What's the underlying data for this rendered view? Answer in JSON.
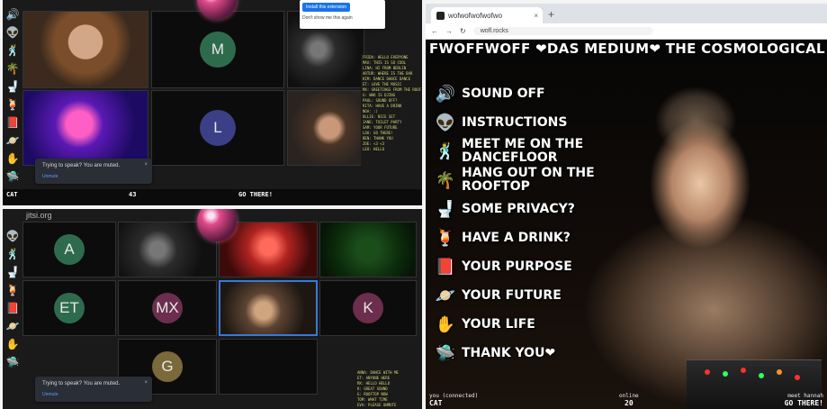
{
  "top_left": {
    "rail_icons": [
      "🔊",
      "👽",
      "🕺",
      "🌴",
      "🚽",
      "🍹",
      "📕",
      "🪐",
      "✋",
      "🛸"
    ],
    "tiles": [
      {
        "initial": "M",
        "color": "#2e6b4c"
      },
      {
        "initial": "L",
        "color": "#3b3f86"
      }
    ],
    "notification": {
      "text": "Trying to speak? You are muted.",
      "link": "Unmute"
    },
    "popup": {
      "button": "Install this extension",
      "text": "Don't show me this again"
    },
    "status": {
      "user": "CAT",
      "online_count": "43",
      "go_there": "GO THERE!"
    },
    "chat_lines": [
      "FRIDA: HELLO EVERYONE",
      "MAX: THIS IS SO COOL",
      "LINA: HI FROM BERLIN",
      "ARTUR: WHERE IS THE BAR",
      "KIM: DANCE DANCE DANCE",
      "ET: LOVE THE MUSIC",
      "MX: GREETINGS FROM THE ROOF",
      "G: WHO IS DJING",
      "PAUL: SOUND OFF?",
      "RITA: HAVE A DRINK",
      "NOA: :)",
      "OLLIE: NICE SET",
      "JANE: TOILET PARTY",
      "SAM: YOUR FUTURE",
      "LOU: GO THERE!",
      "BEN: THANK YOU",
      "ZOE: <3 <3",
      "LEO: HELLO"
    ]
  },
  "bottom_left": {
    "url_text": "jitsi.org",
    "rail_icons": [
      "👽",
      "🕺",
      "🚽",
      "🍹",
      "📕",
      "🪐",
      "✋",
      "🛸"
    ],
    "tiles": [
      {
        "initial": "A",
        "color": "#2e6b4c"
      },
      {
        "initial": "ET",
        "color": "#2e6b4c"
      },
      {
        "initial": "MX",
        "color": "#6b2e4c"
      },
      {
        "initial": "K",
        "color": "#6b2e4c"
      },
      {
        "initial": "G",
        "color": "#7a6a3a"
      }
    ],
    "notification": {
      "text": "Trying to speak? You are muted.",
      "link": "Unmute"
    },
    "chat_lines": [
      "ANNA: DANCE WITH ME",
      "ET: ANYONE HERE",
      "MX: HELLO HELLO",
      "K: GREAT SOUND",
      "G: ROOFTOP NOW",
      "TOM: WHAT TIME",
      "EVA: PLEASE UNMUTE"
    ]
  },
  "browser": {
    "tab_title": "wofwofwofwofwo",
    "url": "wofl.rocks"
  },
  "site": {
    "marquee": "FWOFFWOFF ❤DAS MEDIUM❤ THE COSMOLOGICAL",
    "menu": [
      {
        "icon": "🔊",
        "icon_name": "speaker-icon",
        "label": "SOUND OFF"
      },
      {
        "icon": "👽",
        "icon_name": "alien-icon",
        "label": "INSTRUCTIONS"
      },
      {
        "icon": "🕺",
        "icon_name": "dancer-icon",
        "label": "MEET ME ON THE DANCEFLOOR"
      },
      {
        "icon": "🌴",
        "icon_name": "palm-tree-icon",
        "label": "HANG OUT ON THE ROOFTOP"
      },
      {
        "icon": "🚽",
        "icon_name": "toilet-icon",
        "label": "SOME PRIVACY?"
      },
      {
        "icon": "🍹",
        "icon_name": "cocktail-icon",
        "label": "HAVE A DRINK?"
      },
      {
        "icon": "📕",
        "icon_name": "book-icon",
        "label": "YOUR PURPOSE"
      },
      {
        "icon": "🪐",
        "icon_name": "planet-icon",
        "label": "YOUR FUTURE"
      },
      {
        "icon": "✋",
        "icon_name": "hand-icon",
        "label": "YOUR LIFE"
      },
      {
        "icon": "🛸",
        "icon_name": "ufo-icon",
        "label": "THANK YOU❤"
      }
    ],
    "status": {
      "user_label": "you (connected)",
      "user": "CAT",
      "online_label": "online",
      "online_count": "20",
      "room_label": "meet hannah",
      "go_there": "GO THERE!"
    }
  }
}
